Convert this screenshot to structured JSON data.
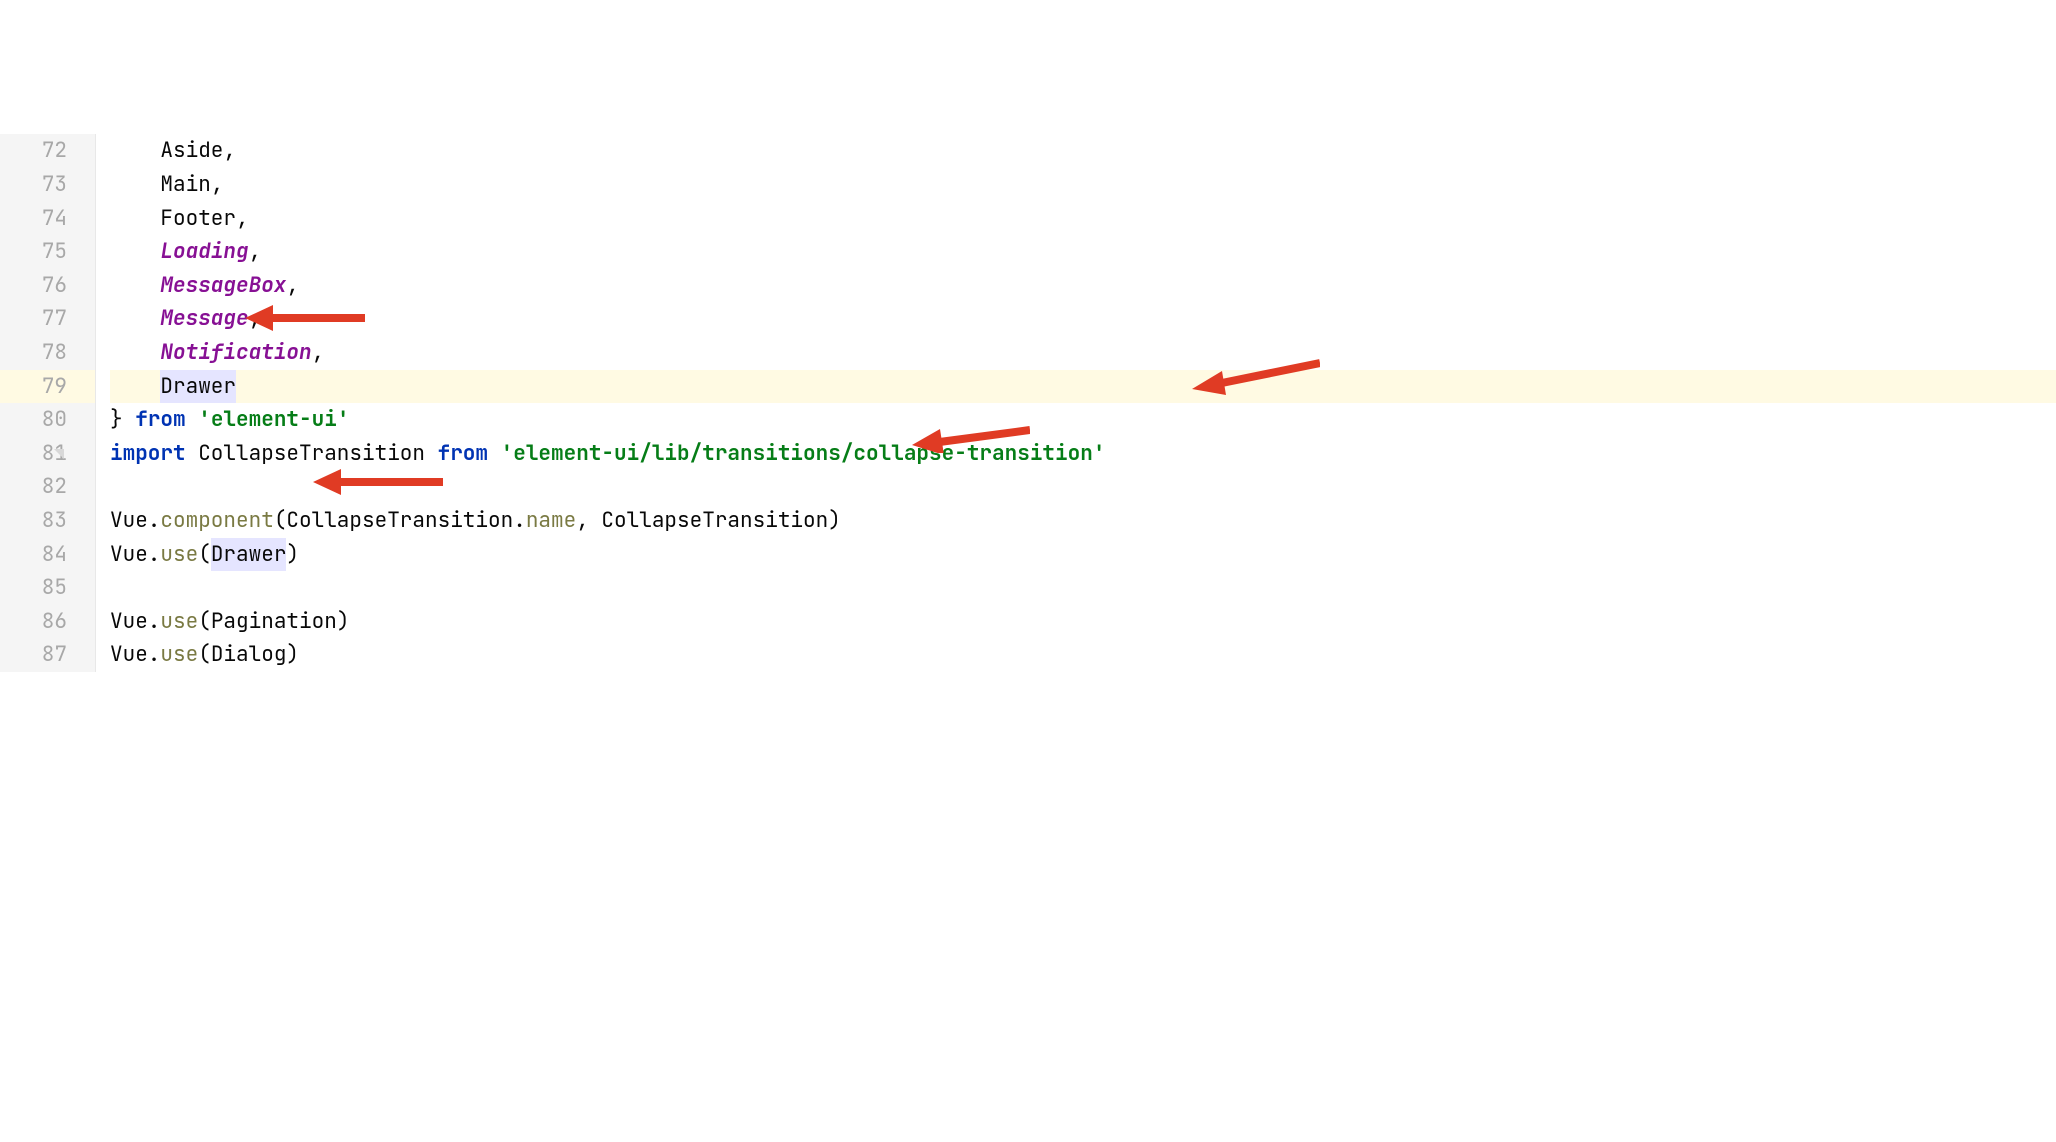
{
  "lines": {
    "l72": {
      "num": "72",
      "indent": "    ",
      "t0": "Aside",
      "t1": ","
    },
    "l73": {
      "num": "73",
      "indent": "    ",
      "t0": "Main",
      "t1": ","
    },
    "l74": {
      "num": "74",
      "indent": "    ",
      "t0": "Footer",
      "t1": ","
    },
    "l75": {
      "num": "75",
      "indent": "    ",
      "t0": "Loading",
      "t1": ","
    },
    "l76": {
      "num": "76",
      "indent": "    ",
      "t0": "MessageBox",
      "t1": ","
    },
    "l77": {
      "num": "77",
      "indent": "    ",
      "t0": "Message",
      "t1": ","
    },
    "l78": {
      "num": "78",
      "indent": "    ",
      "t0": "Notification",
      "t1": ","
    },
    "l79": {
      "num": "79",
      "indent": "    ",
      "t0": "Drawer"
    },
    "l80": {
      "num": "80",
      "t0": "} ",
      "t1": "from",
      "t2": " ",
      "t3": "'element-ui'"
    },
    "l81": {
      "num": "81",
      "t0": "import",
      "t1": " CollapseTransition ",
      "t2": "from",
      "t3": " ",
      "t4": "'element-ui/lib/transitions/collapse-transition'"
    },
    "l82": {
      "num": "82"
    },
    "l83": {
      "num": "83",
      "t0": "Vue.",
      "t1": "component",
      "t2": "(CollapseTransition.",
      "t3": "name",
      "t4": ", CollapseTransition)"
    },
    "l84": {
      "num": "84",
      "t0": "Vue.",
      "t1": "use",
      "t2": "(",
      "t3": "Drawer",
      "t4": ")"
    },
    "l85": {
      "num": "85"
    },
    "l86": {
      "num": "86",
      "t0": "Vue.",
      "t1": "use",
      "t2": "(Pagination)"
    },
    "l87": {
      "num": "87",
      "t0": "Vue.",
      "t1": "use",
      "t2": "(Dialog)"
    }
  }
}
